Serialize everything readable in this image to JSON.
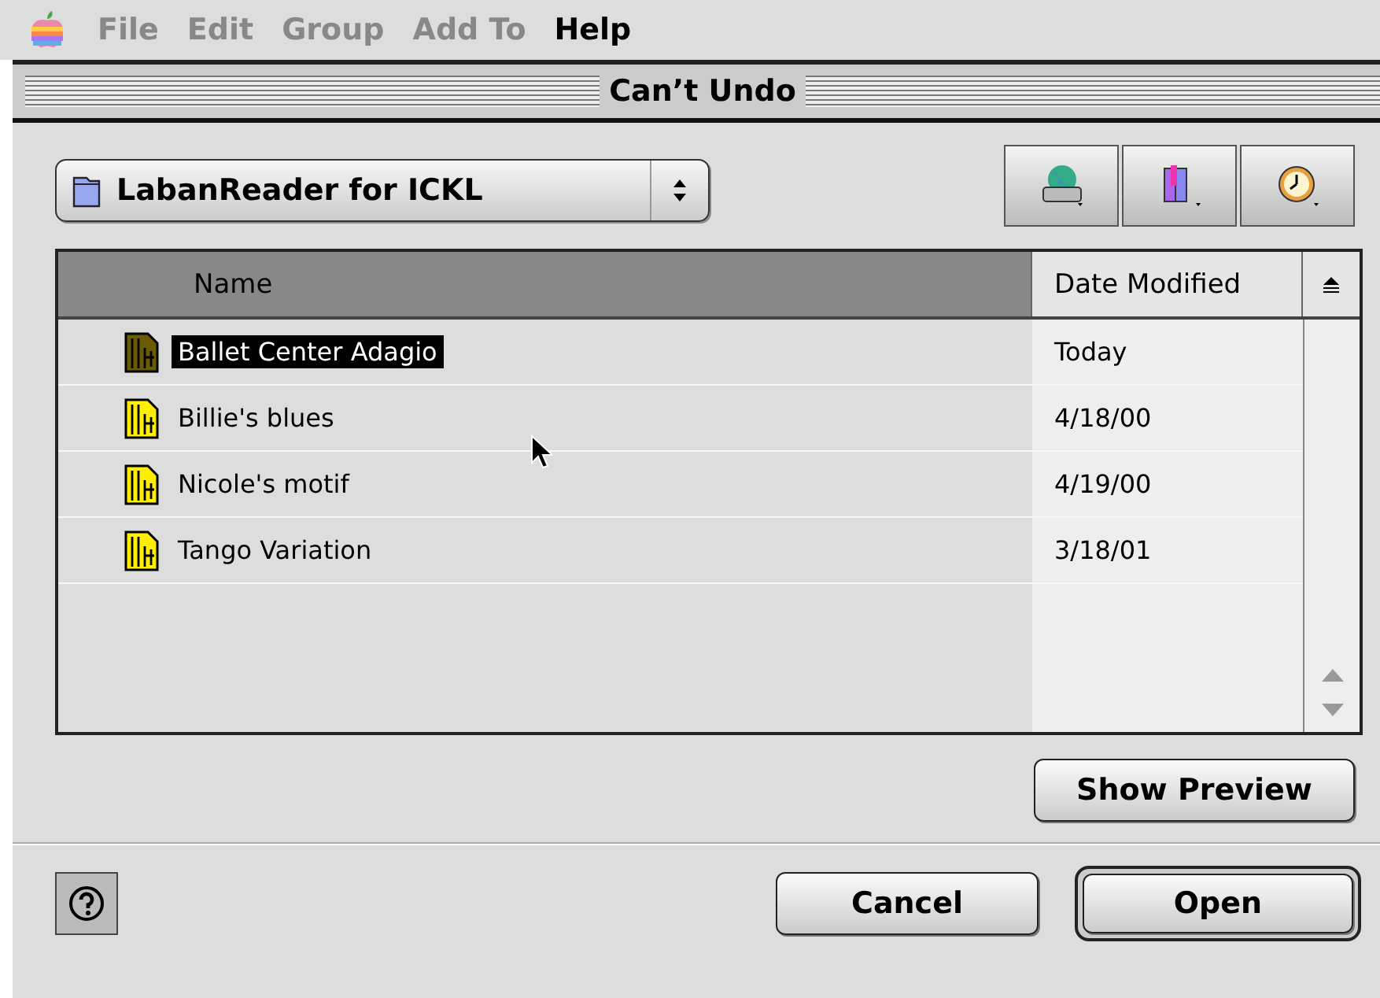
{
  "menu_bar": {
    "items": [
      {
        "label": "File",
        "disabled": true
      },
      {
        "label": "Edit",
        "disabled": true
      },
      {
        "label": "Group",
        "disabled": true
      },
      {
        "label": "Add To",
        "disabled": true
      },
      {
        "label": "Help",
        "disabled": false
      }
    ]
  },
  "window": {
    "title": "Can’t Undo"
  },
  "location_popup": {
    "label": "LabanReader for ICKL"
  },
  "table": {
    "columns": [
      {
        "label": "Name",
        "selected": true
      },
      {
        "label": "Date Modified",
        "selected": false
      }
    ],
    "rows": [
      {
        "name": "Ballet Center Adagio",
        "date": "Today",
        "selected": true
      },
      {
        "name": "Billie's blues",
        "date": "4/18/00",
        "selected": false
      },
      {
        "name": "Nicole's motif",
        "date": "4/19/00",
        "selected": false
      },
      {
        "name": "Tango Variation",
        "date": "3/18/01",
        "selected": false
      }
    ]
  },
  "buttons": {
    "preview": "Show Preview",
    "cancel": "Cancel",
    "open": "Open"
  }
}
